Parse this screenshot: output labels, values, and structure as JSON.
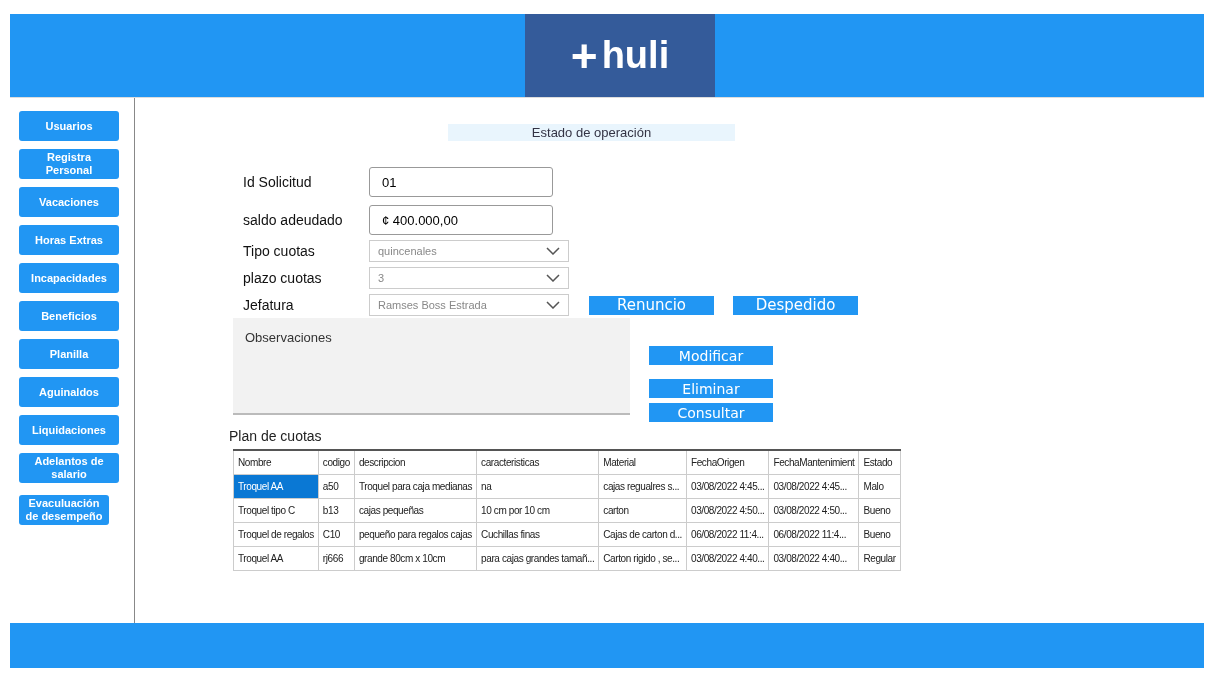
{
  "header": {
    "logo": {
      "mark": "+",
      "text": "huli"
    }
  },
  "sidebar": {
    "items": [
      {
        "label": "Usuarios"
      },
      {
        "label": "Registra Personal"
      },
      {
        "label": "Vacaciones"
      },
      {
        "label": "Horas Extras"
      },
      {
        "label": "Incapacidades"
      },
      {
        "label": "Beneficios"
      },
      {
        "label": "Planilla"
      },
      {
        "label": "Aguinaldos"
      },
      {
        "label": "Liquidaciones"
      },
      {
        "label": "Adelantos de salario"
      },
      {
        "label": "Evaculuación de desempeño"
      }
    ]
  },
  "form": {
    "title": "Estado de operación",
    "fields": [
      {
        "kind": "text",
        "label": "Id Solicitud",
        "value": "01"
      },
      {
        "kind": "text",
        "label": "saldo adeudado",
        "value": "¢ 400.000,00"
      },
      {
        "kind": "select",
        "label": "Tipo cuotas",
        "value": "quincenales"
      },
      {
        "kind": "select",
        "label": "plazo cuotas",
        "value": "3"
      },
      {
        "kind": "select",
        "label": "Jefatura",
        "value": "Ramses Boss Estrada"
      }
    ],
    "status_buttons": [
      "Renuncio",
      "Despedido"
    ],
    "observations": {
      "placeholder": "Observaciones"
    },
    "action_buttons": [
      "Modificar",
      "Eliminar",
      "Consultar"
    ]
  },
  "table": {
    "title": "Plan de cuotas",
    "columns": [
      "Nombre",
      "codigo",
      "descripcion",
      "caracteristicas",
      "Material",
      "FechaOrigen",
      "FechaMantenimient",
      "Estado"
    ],
    "rows": [
      {
        "selected": true,
        "cells": [
          "Troquel AA",
          "a50",
          "Troquel para caja medianas",
          "na",
          "cajas regualres s...",
          "03/08/2022 4:45...",
          "03/08/2022 4:45...",
          "Malo"
        ]
      },
      {
        "selected": false,
        "cells": [
          "Troquel tipo C",
          "b13",
          "cajas pequeñas",
          "10 cm por 10 cm",
          "carton",
          "03/08/2022 4:50...",
          "03/08/2022 4:50...",
          "Bueno"
        ]
      },
      {
        "selected": false,
        "cells": [
          "Troquel de regalos",
          "C10",
          "pequeño para regalos cajas",
          "Cuchillas finas",
          "Cajas de carton d...",
          "06/08/2022 11:4...",
          "06/08/2022 11:4...",
          "Bueno"
        ]
      },
      {
        "selected": false,
        "cells": [
          "Troquel AA",
          "rj666",
          "grande 80cm x 10cm",
          "para cajas grandes tamañ...",
          "Carton rigido , se...",
          "03/08/2022 4:40...",
          "03/08/2022 4:40...",
          "Regular"
        ]
      }
    ]
  }
}
